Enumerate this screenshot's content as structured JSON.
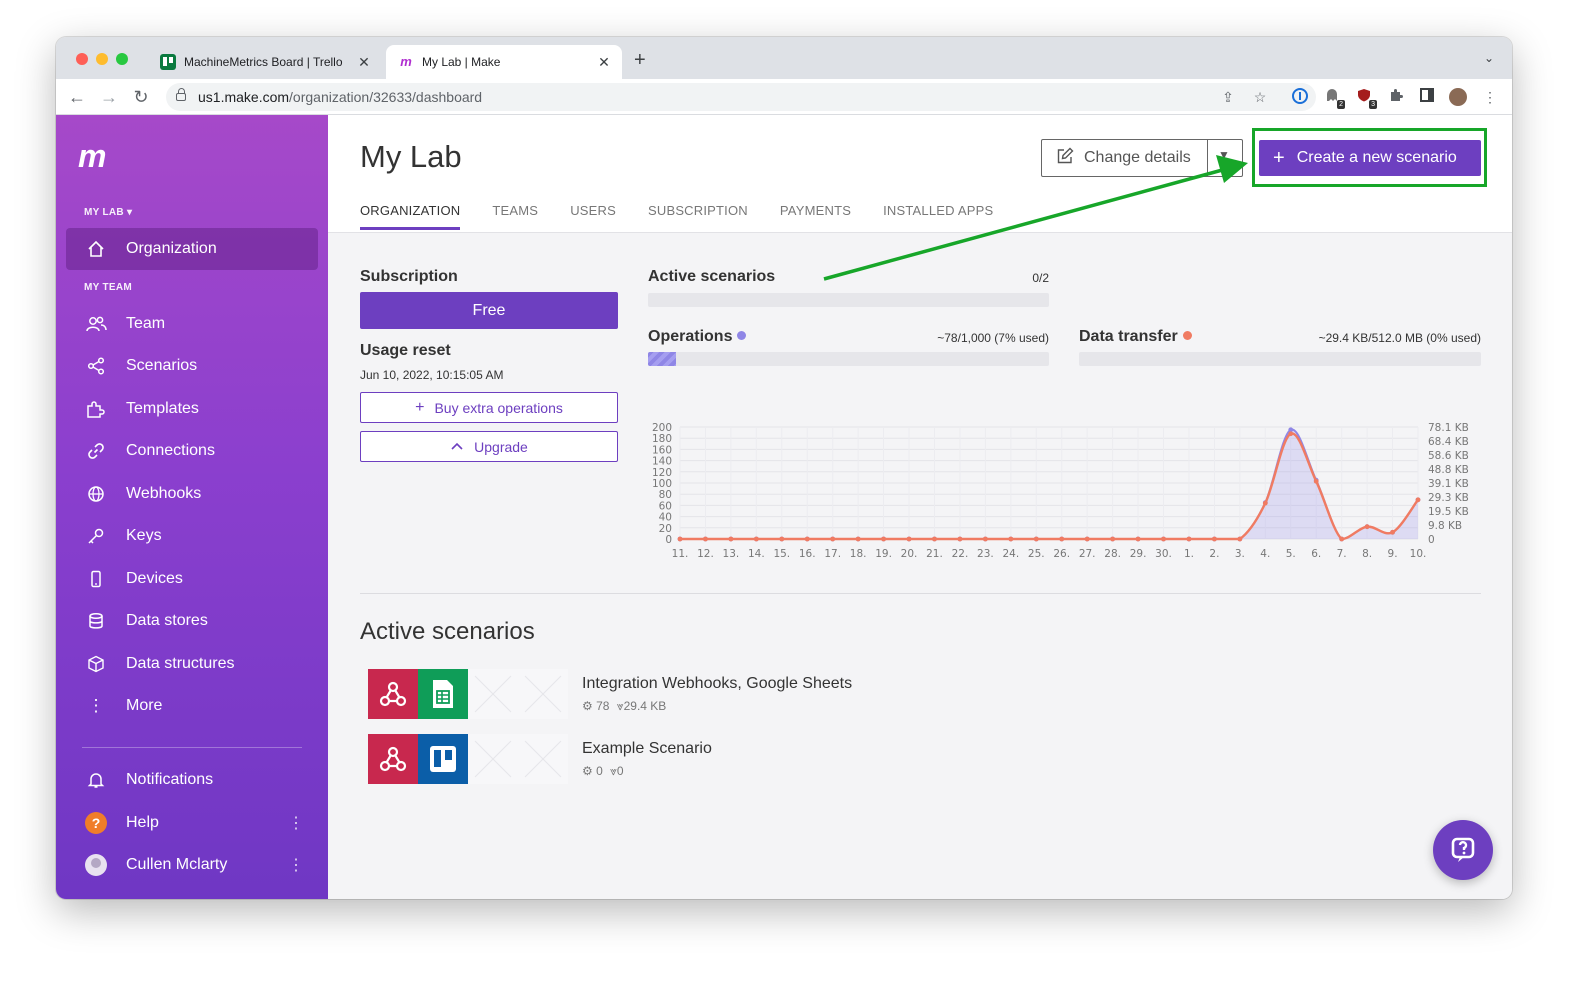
{
  "browser": {
    "tabs": [
      {
        "title": "MachineMetrics Board | Trello",
        "active": false,
        "favicon": "trello-icon"
      },
      {
        "title": "My Lab | Make",
        "active": true,
        "favicon": "make-icon"
      }
    ],
    "url_host": "us1.make.com",
    "url_path": "/organization/32633/dashboard",
    "extension_badges": [
      "2",
      "3"
    ]
  },
  "sidebar": {
    "logo": "m",
    "org_section": "MY LAB ▾",
    "team_section": "MY TEAM",
    "items": [
      {
        "label": "Organization",
        "icon": "home-icon",
        "active": true
      },
      {
        "label": "Team",
        "icon": "users-icon"
      },
      {
        "label": "Scenarios",
        "icon": "share-nodes-icon"
      },
      {
        "label": "Templates",
        "icon": "puzzle-icon"
      },
      {
        "label": "Connections",
        "icon": "link-icon"
      },
      {
        "label": "Webhooks",
        "icon": "globe-icon"
      },
      {
        "label": "Keys",
        "icon": "key-icon"
      },
      {
        "label": "Devices",
        "icon": "phone-icon"
      },
      {
        "label": "Data stores",
        "icon": "database-icon"
      },
      {
        "label": "Data structures",
        "icon": "cube-icon"
      },
      {
        "label": "More",
        "icon": "more-vertical-icon"
      }
    ],
    "bottom": [
      {
        "label": "Notifications",
        "icon": "bell-icon"
      },
      {
        "label": "Help",
        "icon": "help-icon"
      },
      {
        "label": "Cullen Mclarty",
        "icon": "avatar"
      }
    ]
  },
  "header": {
    "title": "My Lab",
    "change_details": "Change details",
    "create_scenario": "Create a new scenario",
    "tabs": [
      "ORGANIZATION",
      "TEAMS",
      "USERS",
      "SUBSCRIPTION",
      "PAYMENTS",
      "INSTALLED APPS"
    ]
  },
  "subscription": {
    "heading": "Subscription",
    "plan": "Free",
    "usage_reset_heading": "Usage reset",
    "usage_reset_date": "Jun 10, 2022, 10:15:05 AM",
    "buy_extra": "Buy extra operations",
    "upgrade": "Upgrade"
  },
  "metrics": {
    "active_scenarios": {
      "label": "Active scenarios",
      "value": "0/2",
      "fraction": 0
    },
    "operations": {
      "label": "Operations",
      "value": "~78/1,000 (7% used)",
      "fraction": 0.07,
      "color": "#8f86e6"
    },
    "data_transfer": {
      "label": "Data transfer",
      "value": "~29.4 KB/512.0 MB (0% used)",
      "fraction": 0,
      "color": "#f07b62"
    }
  },
  "chart_data": {
    "type": "line",
    "x": [
      "11.",
      "12.",
      "13.",
      "14.",
      "15.",
      "16.",
      "17.",
      "18.",
      "19.",
      "20.",
      "21.",
      "22.",
      "23.",
      "24.",
      "25.",
      "26.",
      "27.",
      "28.",
      "29.",
      "30.",
      "1.",
      "2.",
      "3.",
      "4.",
      "5.",
      "6.",
      "7.",
      "8.",
      "9.",
      "10."
    ],
    "ylim": [
      0,
      200
    ],
    "yticks": [
      "200",
      "180",
      "160",
      "140",
      "120",
      "100",
      "80",
      "60",
      "40",
      "20",
      "0"
    ],
    "y2ticks": [
      "78.1 KB",
      "68.4 KB",
      "58.6 KB",
      "48.8 KB",
      "39.1 KB",
      "29.3 KB",
      "19.5 KB",
      "9.8 KB",
      "0"
    ],
    "series": [
      {
        "name": "Operations",
        "color": "#8f86e6",
        "values": [
          0,
          0,
          0,
          0,
          0,
          0,
          0,
          0,
          0,
          0,
          0,
          0,
          0,
          0,
          0,
          0,
          0,
          0,
          0,
          0,
          0,
          0,
          0,
          65,
          195,
          105,
          0,
          22,
          12,
          70
        ]
      },
      {
        "name": "Data transfer",
        "color": "#f07b62",
        "values": [
          0,
          0,
          0,
          0,
          0,
          0,
          0,
          0,
          0,
          0,
          0,
          0,
          0,
          0,
          0,
          0,
          0,
          0,
          0,
          0,
          0,
          0,
          0,
          64,
          188,
          103,
          0,
          22,
          12,
          70
        ]
      }
    ],
    "grid": true
  },
  "active_scenarios": {
    "heading": "Active scenarios",
    "items": [
      {
        "name": "Integration Webhooks, Google Sheets",
        "ops": "78",
        "transfer": "29.4 KB",
        "modules": [
          "webhook-icon",
          "google-sheets-icon"
        ]
      },
      {
        "name": "Example Scenario",
        "ops": "0",
        "transfer": "0",
        "modules": [
          "webhook-icon",
          "trello-icon"
        ]
      }
    ]
  },
  "colors": {
    "accent": "#6d3fc0",
    "sidebar_top": "#a649c9",
    "sidebar_bottom": "#6f37c4",
    "annotation": "#17a629"
  }
}
